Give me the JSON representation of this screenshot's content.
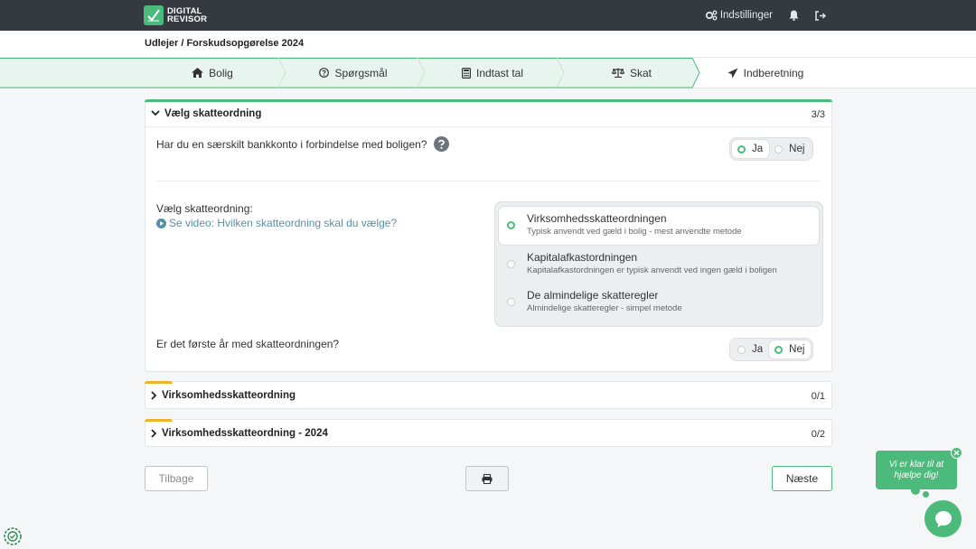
{
  "app": {
    "logo_line1": "DIGITAL",
    "logo_line2": "REVISOR"
  },
  "topbar": {
    "settings_label": "Indstillinger"
  },
  "breadcrumb": "Udlejer / Forskudsopgørelse 2024",
  "steps": [
    {
      "label": "Bolig",
      "icon": "home-icon"
    },
    {
      "label": "Spørgsmål",
      "icon": "question-circle-icon"
    },
    {
      "label": "Indtast tal",
      "icon": "calculator-icon"
    },
    {
      "label": "Skat",
      "icon": "balance-scale-icon",
      "active": true
    },
    {
      "label": "Indberetning",
      "icon": "paper-plane-icon"
    }
  ],
  "section1": {
    "title": "Vælg skatteordning",
    "count": "3/3",
    "q1": {
      "text": "Har du en særskilt bankkonto i forbindelse med boligen?",
      "yes": "Ja",
      "no": "Nej",
      "selected": "Ja"
    },
    "q2": {
      "text": "Vælg skatteordning:",
      "video_link": "Se video: Hvilken skatteordning skal du vælge?",
      "options": [
        {
          "title": "Virksomhedsskatteordningen",
          "sub": "Typisk anvendt ved gæld i bolig - mest anvendte metode",
          "selected": true
        },
        {
          "title": "Kapitalafkastordningen",
          "sub": "Kapitalafkastordningen er typisk anvendt ved ingen gæld i boligen",
          "selected": false
        },
        {
          "title": "De almindelige skatteregler",
          "sub": "Almindelige skatteregler - simpel metode",
          "selected": false
        }
      ]
    },
    "q3": {
      "text": "Er det første år med skatteordningen?",
      "yes": "Ja",
      "no": "Nej",
      "selected": "Nej"
    }
  },
  "section2": {
    "title": "Virksomhedsskatteordning",
    "count": "0/1"
  },
  "section3": {
    "title": "Virksomhedsskatteordning - 2024",
    "count": "0/2"
  },
  "footer": {
    "back": "Tilbage",
    "next": "Næste"
  },
  "chat": {
    "message": "Vi er klar til at hjælpe dig!"
  },
  "colors": {
    "accent": "#4cba7a",
    "step_done_bg": "#e8f5ee",
    "incomplete_bar": "#f0b323",
    "topbar": "#343a40"
  }
}
